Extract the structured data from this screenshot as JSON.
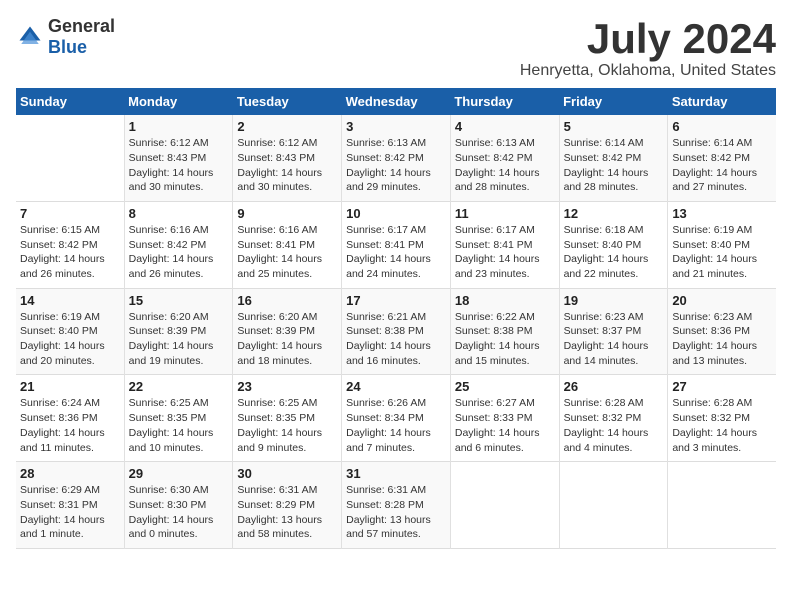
{
  "logo": {
    "text_general": "General",
    "text_blue": "Blue"
  },
  "title": "July 2024",
  "subtitle": "Henryetta, Oklahoma, United States",
  "days_of_week": [
    "Sunday",
    "Monday",
    "Tuesday",
    "Wednesday",
    "Thursday",
    "Friday",
    "Saturday"
  ],
  "weeks": [
    [
      {
        "day": "",
        "info": ""
      },
      {
        "day": "1",
        "info": "Sunrise: 6:12 AM\nSunset: 8:43 PM\nDaylight: 14 hours\nand 30 minutes."
      },
      {
        "day": "2",
        "info": "Sunrise: 6:12 AM\nSunset: 8:43 PM\nDaylight: 14 hours\nand 30 minutes."
      },
      {
        "day": "3",
        "info": "Sunrise: 6:13 AM\nSunset: 8:42 PM\nDaylight: 14 hours\nand 29 minutes."
      },
      {
        "day": "4",
        "info": "Sunrise: 6:13 AM\nSunset: 8:42 PM\nDaylight: 14 hours\nand 28 minutes."
      },
      {
        "day": "5",
        "info": "Sunrise: 6:14 AM\nSunset: 8:42 PM\nDaylight: 14 hours\nand 28 minutes."
      },
      {
        "day": "6",
        "info": "Sunrise: 6:14 AM\nSunset: 8:42 PM\nDaylight: 14 hours\nand 27 minutes."
      }
    ],
    [
      {
        "day": "7",
        "info": "Sunrise: 6:15 AM\nSunset: 8:42 PM\nDaylight: 14 hours\nand 26 minutes."
      },
      {
        "day": "8",
        "info": "Sunrise: 6:16 AM\nSunset: 8:42 PM\nDaylight: 14 hours\nand 26 minutes."
      },
      {
        "day": "9",
        "info": "Sunrise: 6:16 AM\nSunset: 8:41 PM\nDaylight: 14 hours\nand 25 minutes."
      },
      {
        "day": "10",
        "info": "Sunrise: 6:17 AM\nSunset: 8:41 PM\nDaylight: 14 hours\nand 24 minutes."
      },
      {
        "day": "11",
        "info": "Sunrise: 6:17 AM\nSunset: 8:41 PM\nDaylight: 14 hours\nand 23 minutes."
      },
      {
        "day": "12",
        "info": "Sunrise: 6:18 AM\nSunset: 8:40 PM\nDaylight: 14 hours\nand 22 minutes."
      },
      {
        "day": "13",
        "info": "Sunrise: 6:19 AM\nSunset: 8:40 PM\nDaylight: 14 hours\nand 21 minutes."
      }
    ],
    [
      {
        "day": "14",
        "info": "Sunrise: 6:19 AM\nSunset: 8:40 PM\nDaylight: 14 hours\nand 20 minutes."
      },
      {
        "day": "15",
        "info": "Sunrise: 6:20 AM\nSunset: 8:39 PM\nDaylight: 14 hours\nand 19 minutes."
      },
      {
        "day": "16",
        "info": "Sunrise: 6:20 AM\nSunset: 8:39 PM\nDaylight: 14 hours\nand 18 minutes."
      },
      {
        "day": "17",
        "info": "Sunrise: 6:21 AM\nSunset: 8:38 PM\nDaylight: 14 hours\nand 16 minutes."
      },
      {
        "day": "18",
        "info": "Sunrise: 6:22 AM\nSunset: 8:38 PM\nDaylight: 14 hours\nand 15 minutes."
      },
      {
        "day": "19",
        "info": "Sunrise: 6:23 AM\nSunset: 8:37 PM\nDaylight: 14 hours\nand 14 minutes."
      },
      {
        "day": "20",
        "info": "Sunrise: 6:23 AM\nSunset: 8:36 PM\nDaylight: 14 hours\nand 13 minutes."
      }
    ],
    [
      {
        "day": "21",
        "info": "Sunrise: 6:24 AM\nSunset: 8:36 PM\nDaylight: 14 hours\nand 11 minutes."
      },
      {
        "day": "22",
        "info": "Sunrise: 6:25 AM\nSunset: 8:35 PM\nDaylight: 14 hours\nand 10 minutes."
      },
      {
        "day": "23",
        "info": "Sunrise: 6:25 AM\nSunset: 8:35 PM\nDaylight: 14 hours\nand 9 minutes."
      },
      {
        "day": "24",
        "info": "Sunrise: 6:26 AM\nSunset: 8:34 PM\nDaylight: 14 hours\nand 7 minutes."
      },
      {
        "day": "25",
        "info": "Sunrise: 6:27 AM\nSunset: 8:33 PM\nDaylight: 14 hours\nand 6 minutes."
      },
      {
        "day": "26",
        "info": "Sunrise: 6:28 AM\nSunset: 8:32 PM\nDaylight: 14 hours\nand 4 minutes."
      },
      {
        "day": "27",
        "info": "Sunrise: 6:28 AM\nSunset: 8:32 PM\nDaylight: 14 hours\nand 3 minutes."
      }
    ],
    [
      {
        "day": "28",
        "info": "Sunrise: 6:29 AM\nSunset: 8:31 PM\nDaylight: 14 hours\nand 1 minute."
      },
      {
        "day": "29",
        "info": "Sunrise: 6:30 AM\nSunset: 8:30 PM\nDaylight: 14 hours\nand 0 minutes."
      },
      {
        "day": "30",
        "info": "Sunrise: 6:31 AM\nSunset: 8:29 PM\nDaylight: 13 hours\nand 58 minutes."
      },
      {
        "day": "31",
        "info": "Sunrise: 6:31 AM\nSunset: 8:28 PM\nDaylight: 13 hours\nand 57 minutes."
      },
      {
        "day": "",
        "info": ""
      },
      {
        "day": "",
        "info": ""
      },
      {
        "day": "",
        "info": ""
      }
    ]
  ]
}
